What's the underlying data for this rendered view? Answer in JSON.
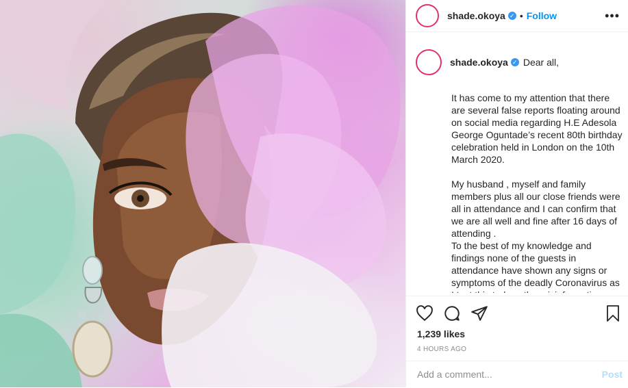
{
  "post": {
    "username": "shade.okoya",
    "verified_badge": "✓",
    "separator": "•",
    "follow_label": "Follow",
    "more_label": "•••",
    "caption_first_line": "Dear all,",
    "caption_body": "\nIt has come to my attention that there are several false reports floating around on social media regarding H.E Adesola George Oguntade’s recent 80th birthday celebration held in London on the 10th March 2020.\n\nMy husband , myself and family members plus all our close friends were all in attendance and I can confirm that we are all well and fine after 16 days of attending .\nTo the best of my knowledge and findings none of the guests in attendance have shown any signs or symptoms of the deadly Coronavirus as I text this today , the misinformation being circulated on",
    "likes": "1,239 likes",
    "timestamp": "4 HOURS AGO"
  },
  "comment": {
    "placeholder": "Add a comment...",
    "post_label": "Post"
  },
  "icons": {
    "like": "heart-icon",
    "comment": "comment-icon",
    "share": "paper-plane-icon",
    "save": "bookmark-icon"
  },
  "colors": {
    "link": "#0095f6",
    "verified": "#3897f0",
    "post_disabled": "#b2dffc"
  }
}
